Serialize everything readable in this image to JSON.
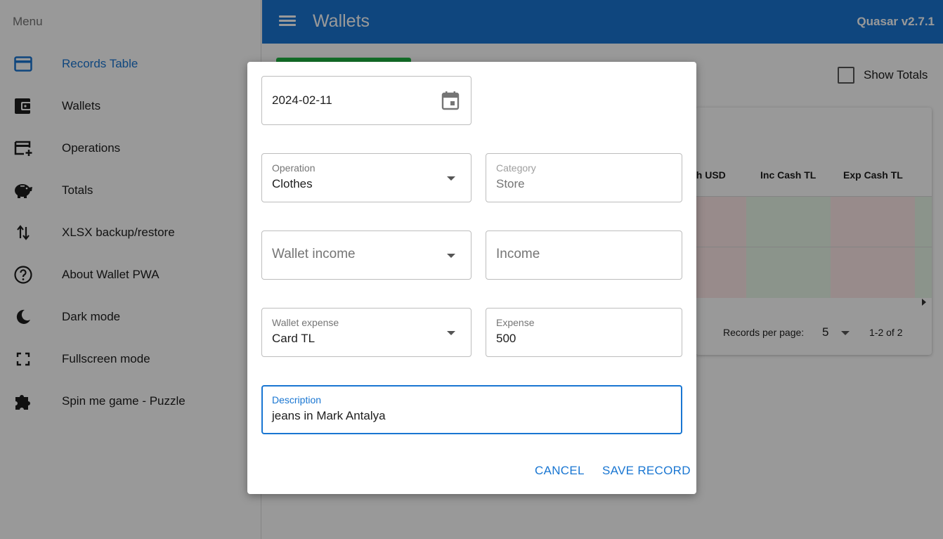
{
  "drawer": {
    "header": "Menu",
    "items": [
      {
        "label": "Records Table",
        "icon": "credit-card-icon"
      },
      {
        "label": "Wallets",
        "icon": "wallet-icon"
      },
      {
        "label": "Operations",
        "icon": "add-card-icon"
      },
      {
        "label": "Totals",
        "icon": "piggy-bank-icon"
      },
      {
        "label": "XLSX backup/restore",
        "icon": "swap-vert-icon"
      },
      {
        "label": "About Wallet PWA",
        "icon": "help-icon"
      },
      {
        "label": "Dark mode",
        "icon": "moon-icon"
      },
      {
        "label": "Fullscreen mode",
        "icon": "fullscreen-icon"
      },
      {
        "label": "Spin me game - Puzzle",
        "icon": "puzzle-icon"
      }
    ]
  },
  "header": {
    "title": "Wallets",
    "version": "Quasar v2.7.1"
  },
  "page": {
    "show_totals_label": "Show Totals",
    "table": {
      "columns": [
        "sh USD",
        "Inc Cash TL",
        "Exp Cash TL"
      ],
      "records_per_page_label": "Records per page:",
      "records_per_page_value": "5",
      "pagination_range": "1-2 of 2"
    }
  },
  "dialog": {
    "date": "2024-02-11",
    "operation": {
      "label": "Operation",
      "value": "Clothes"
    },
    "category": {
      "label": "Category",
      "value": "Store"
    },
    "wallet_income": {
      "placeholder": "Wallet income"
    },
    "income": {
      "placeholder": "Income"
    },
    "wallet_expense": {
      "label": "Wallet expense",
      "value": "Card TL"
    },
    "expense": {
      "label": "Expense",
      "value": "500"
    },
    "description": {
      "label": "Description",
      "value": "jeans in Mark Antalya"
    },
    "cancel_label": "CANCEL",
    "save_label": "SAVE RECORD"
  },
  "colors": {
    "primary": "#1976d2",
    "positive": "#21ba45"
  }
}
